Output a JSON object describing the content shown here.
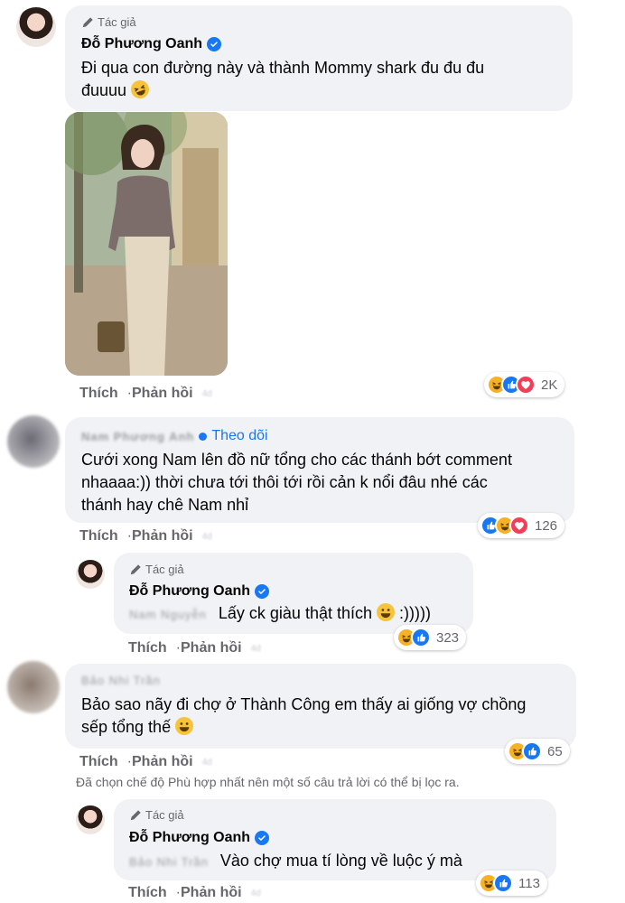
{
  "comments": [
    {
      "tag": "Tác giả",
      "author": "Đỗ Phương Oanh",
      "text_line1": "Đi qua con đường này và thành Mommy shark đu đu đu",
      "text_line2": "đuuuu",
      "text_emoji": "rofl",
      "actions": {
        "like": "Thích",
        "reply": "Phản hồi",
        "time": "4d"
      },
      "reaction_count": "2K",
      "reactions": [
        "haha",
        "like",
        "love"
      ]
    },
    {
      "author_blurred": "Nam Phương Anh",
      "follow_label": "Theo dõi",
      "text_line1": "Cưới xong Nam lên đồ nữ tổng cho các thánh bớt comment",
      "text_line2": "nhaaaa:)) thời chưa tới thôi tới rồi cản k nổi đâu nhé các",
      "text_line3": "thánh hay chê Nam nhỉ",
      "actions": {
        "like": "Thích",
        "reply": "Phản hồi",
        "time": "4d"
      },
      "reaction_count": "126",
      "reactions": [
        "like",
        "haha",
        "love"
      ]
    },
    {
      "tag": "Tác giả",
      "author": "Đỗ Phương Oanh",
      "mention_blurred": "Nam Nguyễn",
      "text": "Lấy ck giàu thật thích",
      "text_suffix": ":)))))",
      "text_emoji": "grin",
      "actions": {
        "like": "Thích",
        "reply": "Phản hồi",
        "time": "4d"
      },
      "reaction_count": "323",
      "reactions": [
        "haha",
        "like"
      ]
    },
    {
      "author_blurred": "Bảo Nhi Trần",
      "text_line1": "Bảo sao nãy đi chợ ở Thành Công em thấy ai giống vợ chồng",
      "text_line2": "sếp tổng thế",
      "text_emoji": "grin",
      "actions": {
        "like": "Thích",
        "reply": "Phản hồi",
        "time": "4d"
      },
      "reaction_count": "65",
      "reactions": [
        "haha",
        "like"
      ]
    },
    {
      "tag": "Tác giả",
      "author": "Đỗ Phương Oanh",
      "mention_blurred": "Bảo Nhi Trần",
      "text": "Vào chợ mua tí lòng về luộc ý mà",
      "actions": {
        "like": "Thích",
        "reply": "Phản hồi",
        "time": "4d"
      },
      "reaction_count": "113",
      "reactions": [
        "haha",
        "like"
      ]
    }
  ],
  "filter_notice": "Đã chọn chế độ Phù hợp nhất nên một số câu trả lời có thể bị lọc ra.",
  "colors": {
    "bubble": "#f0f2f5",
    "secondary_text": "#65676b",
    "accent": "#1877f2",
    "haha": "#f7b125",
    "love": "#f33e58"
  }
}
